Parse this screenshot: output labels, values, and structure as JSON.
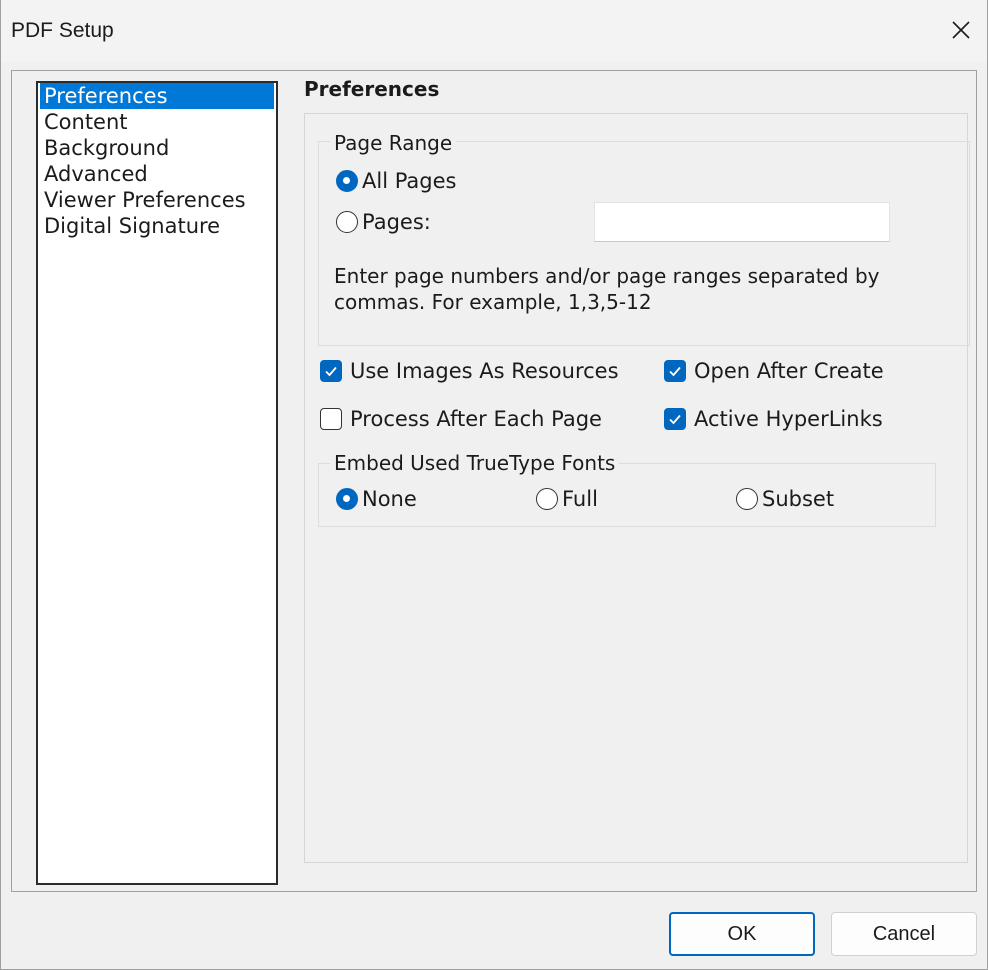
{
  "window": {
    "title": "PDF Setup"
  },
  "nav": {
    "items": [
      {
        "label": "Preferences",
        "selected": true
      },
      {
        "label": "Content",
        "selected": false
      },
      {
        "label": "Background",
        "selected": false
      },
      {
        "label": "Advanced",
        "selected": false
      },
      {
        "label": "Viewer Preferences",
        "selected": false
      },
      {
        "label": "Digital Signature",
        "selected": false
      }
    ]
  },
  "preferences": {
    "title": "Preferences",
    "page_range": {
      "legend": "Page Range",
      "all_pages_label": "All Pages",
      "pages_label": "Pages:",
      "selected": "All Pages",
      "pages_value": "",
      "help_text": "Enter page numbers and/or page ranges separated by commas. For example, 1,3,5-12"
    },
    "options": {
      "use_images_label": "Use Images As Resources",
      "use_images_checked": true,
      "open_after_label": "Open After Create",
      "open_after_checked": true,
      "process_after_label": "Process After Each Page",
      "process_after_checked": false,
      "active_links_label": "Active HyperLinks",
      "active_links_checked": true
    },
    "fonts": {
      "legend": "Embed Used TrueType Fonts",
      "none_label": "None",
      "full_label": "Full",
      "subset_label": "Subset",
      "selected": "None"
    }
  },
  "buttons": {
    "ok_label": "OK",
    "cancel_label": "Cancel"
  },
  "colors": {
    "accent": "#0067c0",
    "selection": "#0078d7"
  },
  "icons": {
    "close": "close-icon",
    "check": "checkmark-icon"
  }
}
